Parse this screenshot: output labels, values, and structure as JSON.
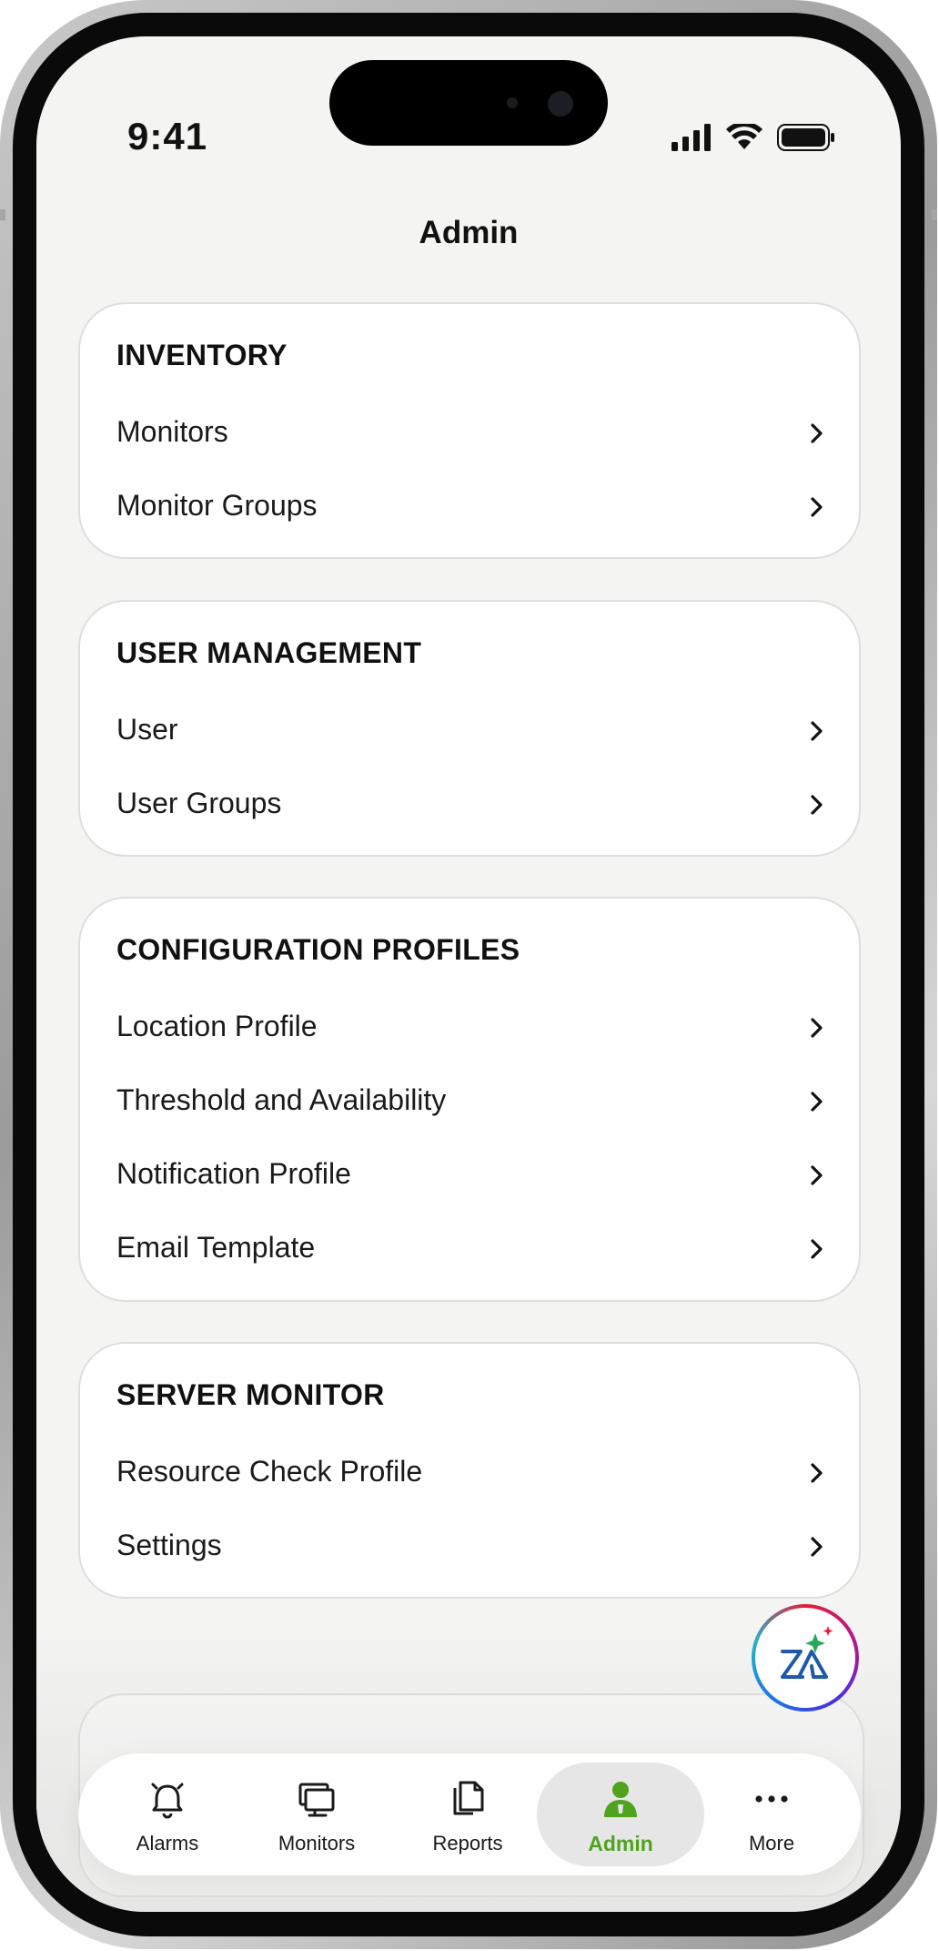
{
  "status_bar": {
    "time": "9:41"
  },
  "nav": {
    "title": "Admin"
  },
  "sections": [
    {
      "header": "INVENTORY",
      "items": [
        "Monitors",
        "Monitor Groups"
      ]
    },
    {
      "header": "USER MANAGEMENT",
      "items": [
        "User",
        "User Groups"
      ]
    },
    {
      "header": "CONFIGURATION PROFILES",
      "items": [
        "Location Profile",
        "Threshold and Availability",
        "Notification Profile",
        "Email Template"
      ]
    },
    {
      "header": "SERVER MONITOR",
      "items": [
        "Resource Check Profile",
        "Settings"
      ]
    }
  ],
  "tab_bar": {
    "tabs": [
      {
        "label": "Alarms",
        "icon": "bell-icon"
      },
      {
        "label": "Monitors",
        "icon": "monitor-icon"
      },
      {
        "label": "Reports",
        "icon": "reports-icon"
      },
      {
        "label": "Admin",
        "icon": "admin-user-icon",
        "active": true
      },
      {
        "label": "More",
        "icon": "ellipsis-icon"
      }
    ]
  },
  "colors": {
    "accent": "#4fa31d",
    "background": "#f4f4f3",
    "card": "#ffffff",
    "text": "#1a1a1a"
  }
}
